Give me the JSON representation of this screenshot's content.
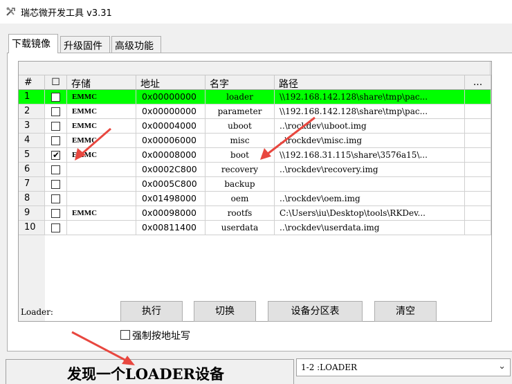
{
  "window": {
    "title": "瑞芯微开发工具 v3.31",
    "icon": "tools-icon"
  },
  "tabs": [
    {
      "label": "下载镜像",
      "active": true
    },
    {
      "label": "升级固件",
      "active": false
    },
    {
      "label": "高级功能",
      "active": false
    }
  ],
  "table": {
    "headers": {
      "num": "#",
      "check": "☐",
      "storage": "存储",
      "address": "地址",
      "name": "名字",
      "path": "路径",
      "extra": "..."
    },
    "rows": [
      {
        "num": "1",
        "checked": false,
        "storage": "EMMC",
        "address": "0x00000000",
        "name": "loader",
        "path": "\\\\192.168.142.128\\share\\tmp\\pac...",
        "selected": true
      },
      {
        "num": "2",
        "checked": false,
        "storage": "EMMC",
        "address": "0x00000000",
        "name": "parameter",
        "path": "\\\\192.168.142.128\\share\\tmp\\pac...",
        "selected": false
      },
      {
        "num": "3",
        "checked": false,
        "storage": "EMMC",
        "address": "0x00004000",
        "name": "uboot",
        "path": "..\\rockdev\\uboot.img",
        "selected": false
      },
      {
        "num": "4",
        "checked": false,
        "storage": "EMMC",
        "address": "0x00006000",
        "name": "misc",
        "path": "..\\rockdev\\misc.img",
        "selected": false
      },
      {
        "num": "5",
        "checked": true,
        "storage": "EMMC",
        "address": "0x00008000",
        "name": "boot",
        "path": "\\\\192.168.31.115\\share\\3576a15\\...",
        "selected": false
      },
      {
        "num": "6",
        "checked": false,
        "storage": "",
        "address": "0x0002C800",
        "name": "recovery",
        "path": "..\\rockdev\\recovery.img",
        "selected": false
      },
      {
        "num": "7",
        "checked": false,
        "storage": "",
        "address": "0x0005C800",
        "name": "backup",
        "path": "",
        "selected": false
      },
      {
        "num": "8",
        "checked": false,
        "storage": "",
        "address": "0x01498000",
        "name": "oem",
        "path": "..\\rockdev\\oem.img",
        "selected": false
      },
      {
        "num": "9",
        "checked": false,
        "storage": "EMMC",
        "address": "0x00098000",
        "name": "rootfs",
        "path": "C:\\Users\\iu\\Desktop\\tools\\RKDev...",
        "selected": false
      },
      {
        "num": "10",
        "checked": false,
        "storage": "",
        "address": "0x00811400",
        "name": "userdata",
        "path": "..\\rockdev\\userdata.img",
        "selected": false
      }
    ]
  },
  "controls": {
    "loader_label": "Loader:",
    "execute": "执行",
    "switch": "切换",
    "partition_table": "设备分区表",
    "clear": "清空",
    "force_address": "强制按地址写"
  },
  "status": {
    "message": "发现一个LOADER设备",
    "device_select": "1-2 :LOADER"
  },
  "colors": {
    "selected_row": "#00ff00",
    "annotation_arrow": "#e8473f"
  }
}
